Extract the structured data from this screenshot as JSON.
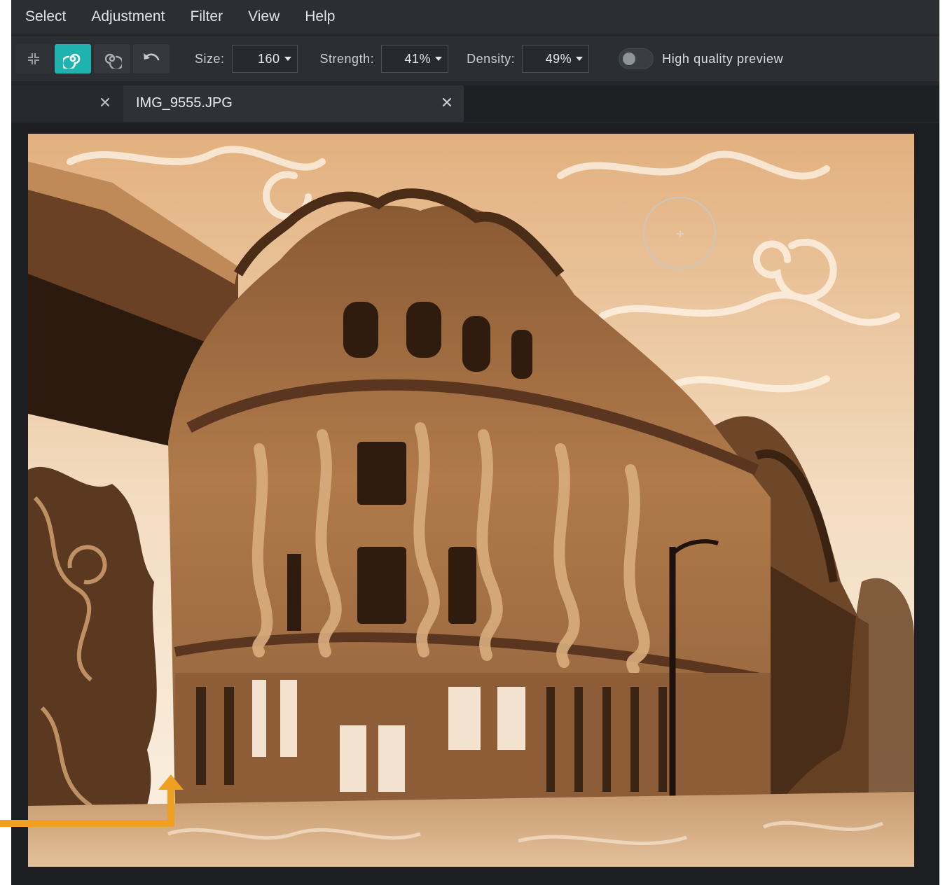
{
  "menu": {
    "items": [
      "Select",
      "Adjustment",
      "Filter",
      "View",
      "Help"
    ]
  },
  "toolbar": {
    "size_label": "Size:",
    "size_value": "160",
    "strength_label": "Strength:",
    "strength_value": "41%",
    "density_label": "Density:",
    "density_value": "49%",
    "hq_preview_label": "High quality preview",
    "hq_preview_on": false,
    "tools": [
      "collapse-icon",
      "twirl-icon",
      "twirl-counterclockwise-icon",
      "undo-icon"
    ],
    "active_tool": "twirl-icon",
    "accent_color": "#1fb3b0"
  },
  "tabs": {
    "active_title": "IMG_9555.JPG"
  },
  "annotation": {
    "arrow_color": "#f0a020"
  }
}
